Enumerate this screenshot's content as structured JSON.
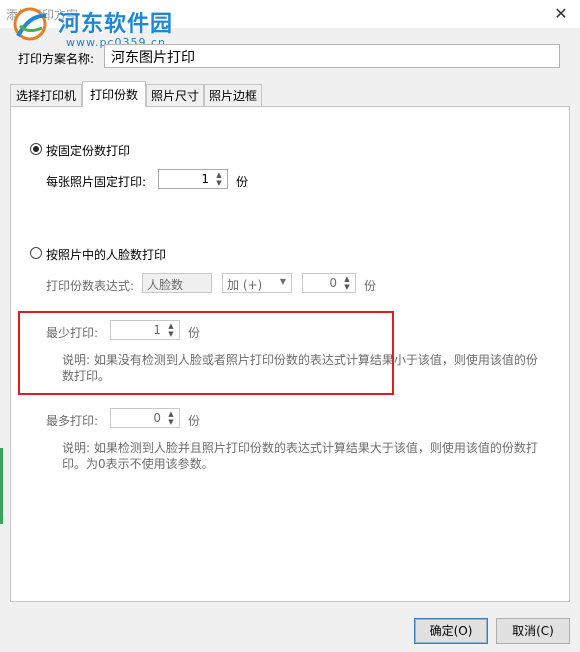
{
  "window": {
    "title": "添加打印方案",
    "close": "✕"
  },
  "watermark": {
    "name": "河东软件园",
    "url": "www.pc0359.cn"
  },
  "scheme_name": {
    "label": "打印方案名称:",
    "value": "河东图片打印"
  },
  "tabs": [
    {
      "label": "选择打印机",
      "active": false
    },
    {
      "label": "打印份数",
      "active": true
    },
    {
      "label": "照片尺寸",
      "active": false
    },
    {
      "label": "照片边框",
      "active": false
    }
  ],
  "fixed": {
    "radio_label": "按固定份数打印",
    "selected": true,
    "per_photo_label": "每张照片固定打印:",
    "per_photo_value": "1",
    "unit": "份"
  },
  "face": {
    "radio_label": "按照片中的人脸数打印",
    "selected": false,
    "expr_label": "打印份数表达式:",
    "expr_field": "人脸数",
    "operator": "加 (+)",
    "operand": "0",
    "unit": "份",
    "min_label": "最少打印:",
    "min_value": "1",
    "min_unit": "份",
    "min_desc_line1": "说明: 如果没有检测到人脸或者照片打印份数的表达式计算结果小于该值，则使用该值的份",
    "min_desc_line2": "数打印。",
    "max_label": "最多打印:",
    "max_value": "0",
    "max_unit": "份",
    "max_desc_line1": "说明: 如果检测到人脸并且照片打印份数的表达式计算结果大于该值，则使用该值的份数打",
    "max_desc_line2": "印。为0表示不使用该参数。"
  },
  "buttons": {
    "ok": "确定(O)",
    "cancel": "取消(C)"
  },
  "colors": {
    "highlight": "#e21b1b",
    "watermark": "#1e87d8"
  }
}
